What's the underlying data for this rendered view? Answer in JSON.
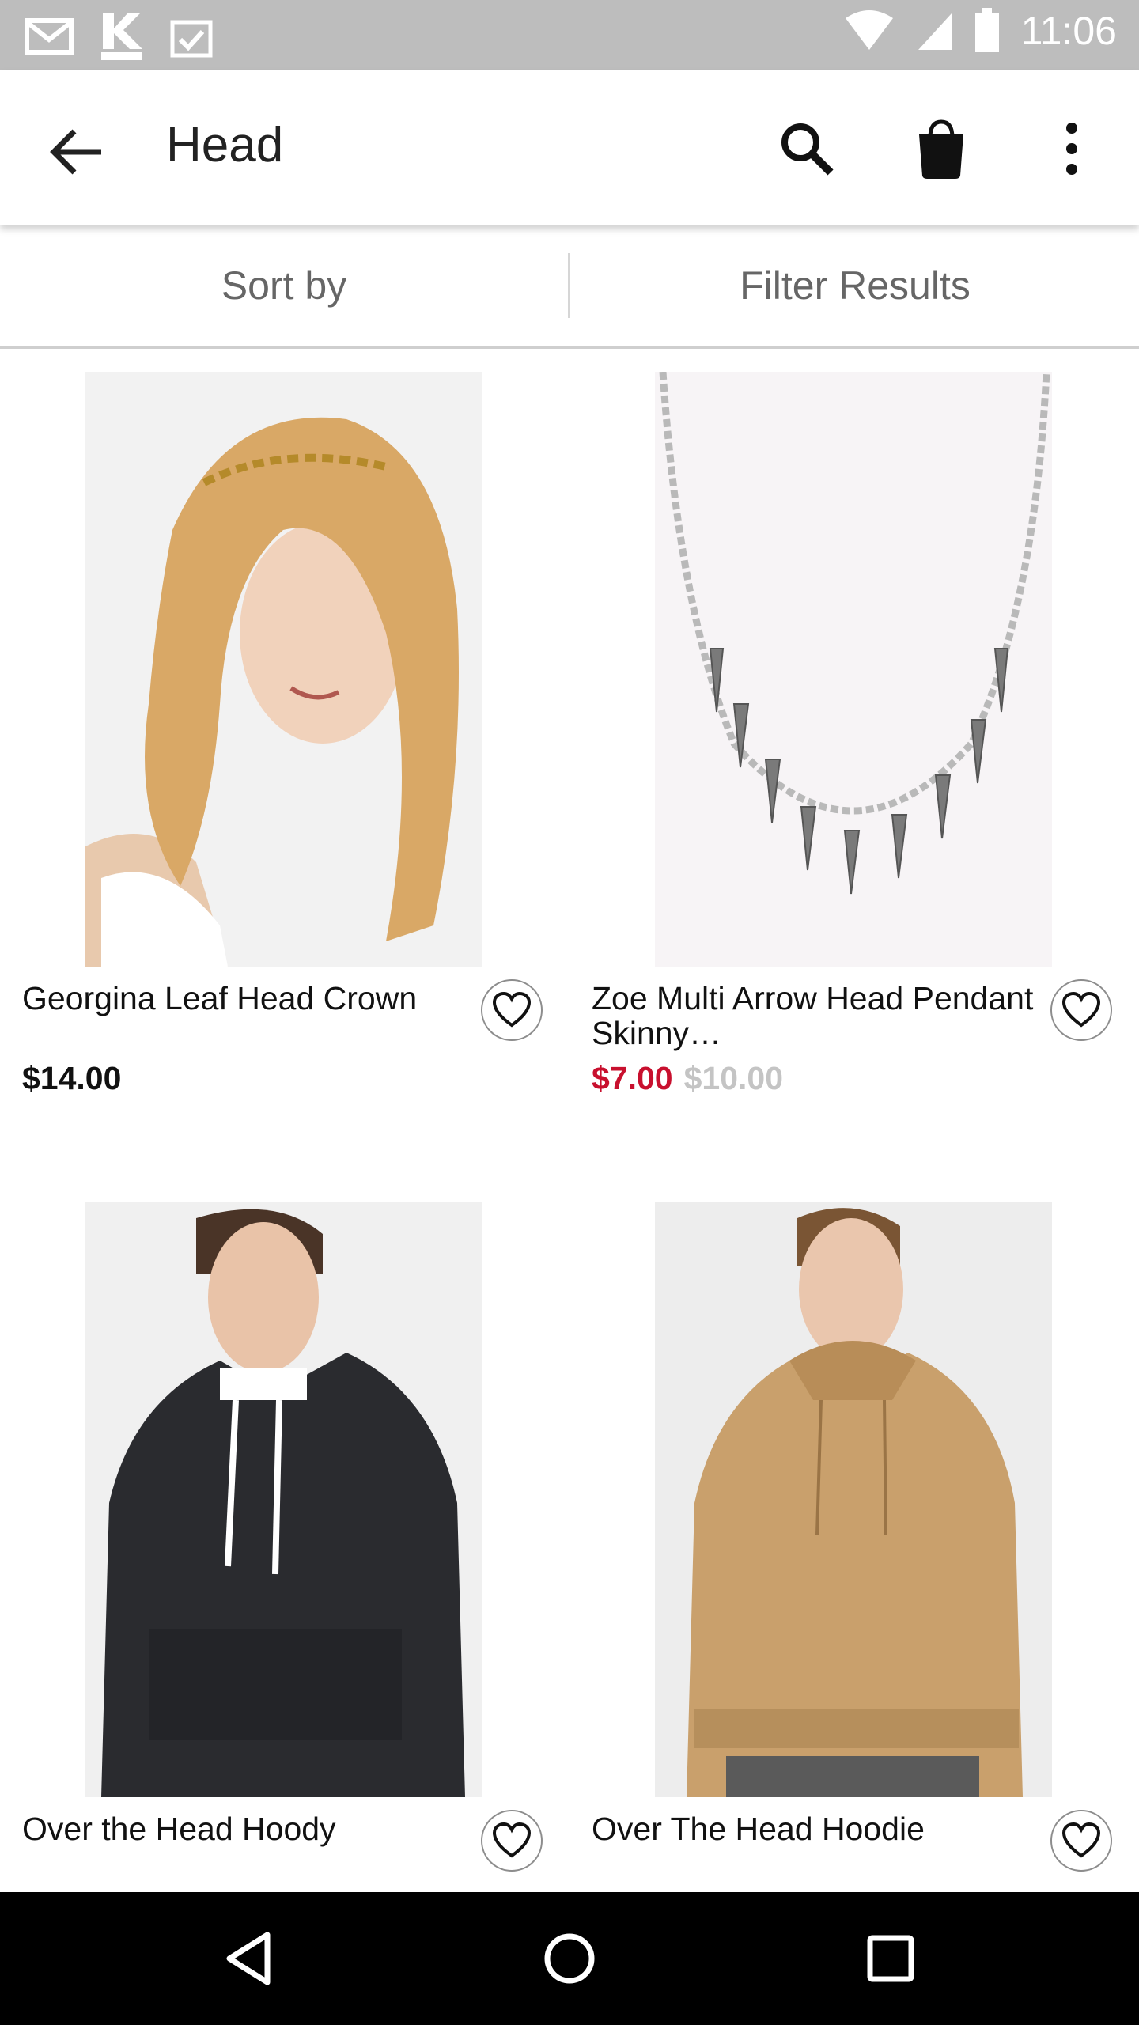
{
  "status_bar": {
    "time": "11:06",
    "icons": [
      "gmail-icon",
      "kmart-icon",
      "calendar-check-icon",
      "wifi-icon",
      "cell-signal-icon",
      "battery-icon"
    ]
  },
  "app_bar": {
    "title": "Head",
    "icons": [
      "back-arrow-icon",
      "search-icon",
      "shopping-bag-icon",
      "more-vert-icon"
    ]
  },
  "toolbar": {
    "sort_label": "Sort by",
    "filter_label": "Filter Results"
  },
  "products": [
    {
      "name": "Georgina Leaf Head Crown",
      "price": "$14.00",
      "sale_price": "",
      "original_price": "",
      "image": "woman with leaf head crown"
    },
    {
      "name": "Zoe Multi Arrow Head Pendant Skinny…",
      "price": "",
      "sale_price": "$7.00",
      "original_price": "$10.00",
      "image": "silver necklace with arrow pendants"
    },
    {
      "name": "Over the Head Hoody",
      "price": "",
      "sale_price": "",
      "original_price": "",
      "image": "man in black hoody"
    },
    {
      "name": "Over The Head Hoodie",
      "price": "",
      "sale_price": "",
      "original_price": "",
      "image": "man in tan hoodie"
    }
  ],
  "colors": {
    "sale": "#c8102e",
    "original_price": "#c4c4c4",
    "status_bar": "#bdbdbd"
  },
  "nav_bar": {
    "icons": [
      "back-triangle-icon",
      "home-circle-icon",
      "recents-square-icon"
    ]
  }
}
